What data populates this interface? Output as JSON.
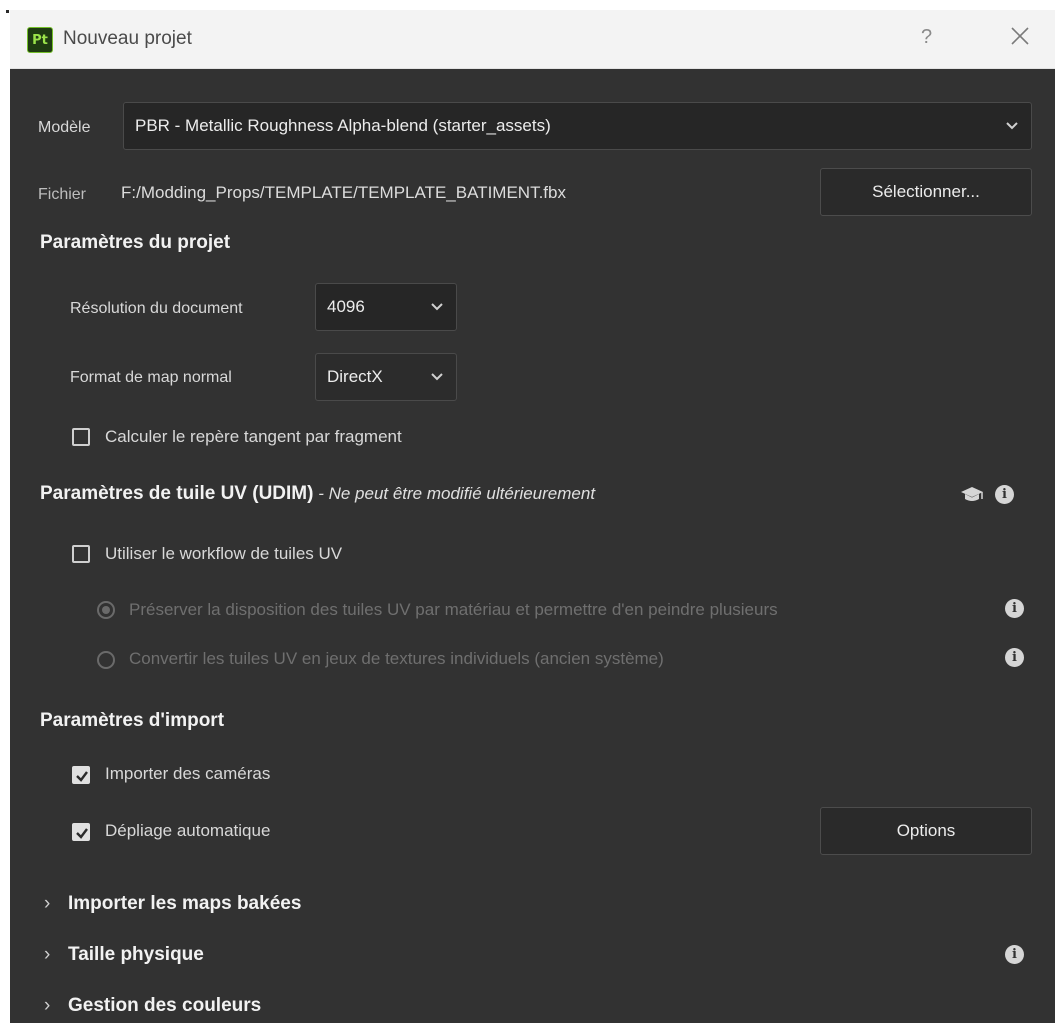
{
  "window": {
    "app_icon_text": "Pt",
    "title": "Nouveau projet",
    "help_label": "?"
  },
  "template": {
    "label": "Modèle",
    "value": "PBR - Metallic Roughness Alpha-blend (starter_assets)"
  },
  "file": {
    "label": "Fichier",
    "path": "F:/Modding_Props/TEMPLATE/TEMPLATE_BATIMENT.fbx",
    "select_button": "Sélectionner..."
  },
  "project_settings": {
    "title": "Paramètres du projet",
    "resolution_label": "Résolution du document",
    "resolution_value": "4096",
    "normal_format_label": "Format de map normal",
    "normal_format_value": "DirectX",
    "tangent_label": "Calculer le repère tangent par fragment",
    "tangent_checked": false
  },
  "udim": {
    "title": "Paramètres de tuile UV (UDIM)",
    "subtitle": " - Ne peut être modifié ultérieurement",
    "use_workflow_label": "Utiliser le workflow de tuiles UV",
    "use_workflow_checked": false,
    "option_preserve": "Préserver la disposition des tuiles UV par matériau et permettre d'en peindre plusieurs",
    "option_convert": "Convertir les tuiles UV en jeux de textures individuels (ancien système)"
  },
  "import_settings": {
    "title": "Paramètres d'import",
    "import_cameras_label": "Importer des caméras",
    "import_cameras_checked": true,
    "auto_unwrap_label": "Dépliage automatique",
    "auto_unwrap_checked": true,
    "options_button": "Options"
  },
  "collapsible_sections": [
    {
      "label": "Importer les maps bakées"
    },
    {
      "label": "Taille physique"
    },
    {
      "label": "Gestion des couleurs"
    }
  ]
}
